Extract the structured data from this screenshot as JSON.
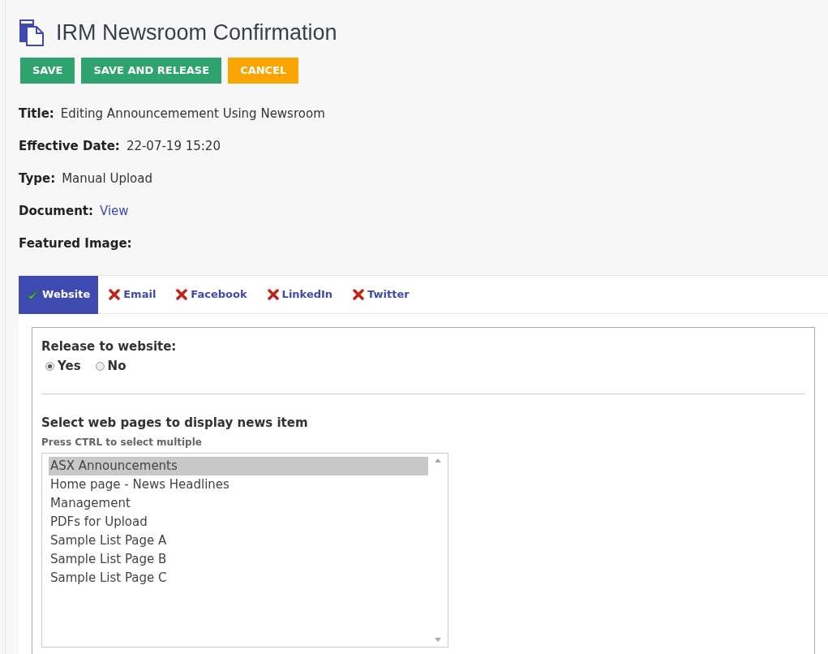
{
  "page": {
    "title": "IRM Newsroom Confirmation"
  },
  "buttons": [
    {
      "label": "SAVE",
      "kind": "primary"
    },
    {
      "label": "SAVE AND RELEASE",
      "kind": "primary"
    },
    {
      "label": "CANCEL",
      "kind": "warning"
    }
  ],
  "fields": [
    {
      "label": "Title:",
      "value": "Editing Announcemement Using Newsroom",
      "kind": "text"
    },
    {
      "label": "Effective Date:",
      "value": "22-07-19 15:20",
      "kind": "text"
    },
    {
      "label": "Type:",
      "value": "Manual Upload",
      "kind": "text"
    },
    {
      "label": "Document:",
      "value": "View",
      "kind": "link"
    },
    {
      "label": "Featured Image:"
    }
  ],
  "tabs": [
    {
      "label": "Website",
      "selected": true,
      "enabled": true
    },
    {
      "label": "Email",
      "selected": false,
      "enabled": false
    },
    {
      "label": "Facebook",
      "selected": false,
      "enabled": false
    },
    {
      "label": "LinkedIn",
      "selected": false,
      "enabled": false
    },
    {
      "label": "Twitter",
      "selected": false,
      "enabled": false
    }
  ],
  "release": {
    "label": "Release to website:",
    "options": [
      {
        "label": "Yes",
        "selected": true
      },
      {
        "label": "No",
        "selected": false
      }
    ]
  },
  "pages": {
    "heading": "Select web pages to display news item",
    "hint": "Press CTRL to select multiple",
    "items": [
      {
        "label": "ASX Announcements",
        "selected": true
      },
      {
        "label": "Home page - News Headlines",
        "selected": false
      },
      {
        "label": "Management",
        "selected": false
      },
      {
        "label": "PDFs for Upload",
        "selected": false
      },
      {
        "label": "Sample List Page A",
        "selected": false
      },
      {
        "label": "Sample List Page B",
        "selected": false
      },
      {
        "label": "Sample List Page C",
        "selected": false
      }
    ]
  }
}
